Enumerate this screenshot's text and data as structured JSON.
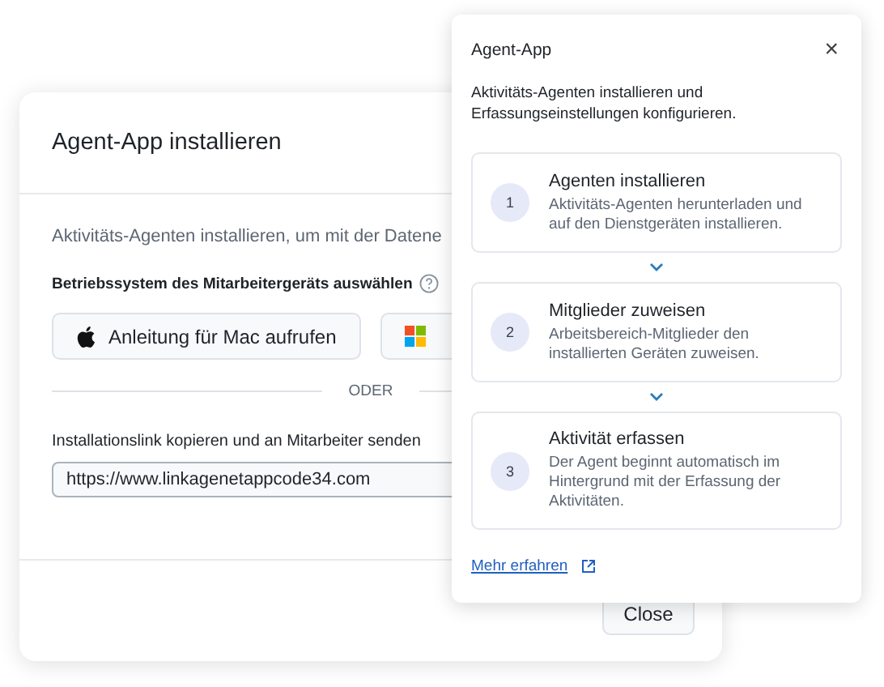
{
  "dialog": {
    "title": "Agent-App installieren",
    "intro": "Aktivitäts-Agenten installieren, um mit der Datene",
    "os_label": "Betriebssystem des Mitarbeitergeräts auswählen",
    "os_buttons": [
      {
        "kind": "mac",
        "label": "Anleitung für Mac aufrufen"
      },
      {
        "kind": "windows"
      }
    ],
    "divider_label": "ODER",
    "link_label": "Installationslink kopieren und an Mitarbeiter senden",
    "link_value": "https://www.linkagenetappcode34.com",
    "close_button": "Close"
  },
  "popover": {
    "title": "Agent-App",
    "close": "×",
    "description": "Aktivitäts-Agenten installieren und Erfassungseinstellungen konfigurieren.",
    "steps": [
      {
        "number": "1",
        "title": "Agenten installieren",
        "text": "Aktivitäts-Agenten herunterladen und auf den Dienstgeräten installieren."
      },
      {
        "number": "2",
        "title": "Mitglieder zuweisen",
        "text": "Arbeitsbereich-Mitglieder den installierten Geräten zuweisen."
      },
      {
        "number": "3",
        "title": "Aktivität erfassen",
        "text": "Der Agent beginnt automatisch im Hintergrund mit der Erfassung der Aktivitäten."
      }
    ],
    "link": "Mehr erfahren"
  }
}
